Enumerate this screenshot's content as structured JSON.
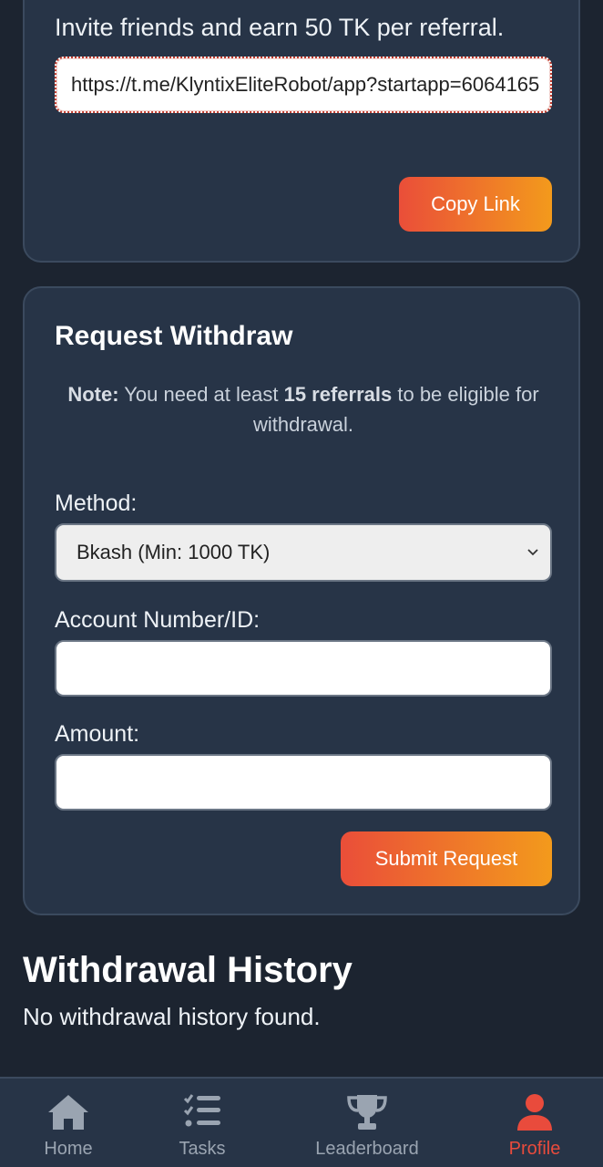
{
  "referral": {
    "invite_text": "Invite friends and earn 50 TK per referral.",
    "link_value": "https://t.me/KlyntixEliteRobot/app?startapp=6064165",
    "copy_label": "Copy Link"
  },
  "withdraw": {
    "title": "Request Withdraw",
    "note_prefix": "Note:",
    "note_text_1": " You need at least ",
    "note_bold": "15 referrals",
    "note_text_2": " to be eligible for withdrawal.",
    "method_label": "Method:",
    "method_value": "Bkash (Min: 1000 TK)",
    "account_label": "Account Number/ID:",
    "amount_label": "Amount:",
    "submit_label": "Submit Request"
  },
  "history": {
    "title": "Withdrawal History",
    "empty_text": "No withdrawal history found."
  },
  "nav": {
    "home": "Home",
    "tasks": "Tasks",
    "leaderboard": "Leaderboard",
    "profile": "Profile",
    "active": "profile"
  },
  "colors": {
    "accent_start": "#ea4e39",
    "accent_end": "#f39a1c",
    "active_nav": "#e94b3c"
  }
}
